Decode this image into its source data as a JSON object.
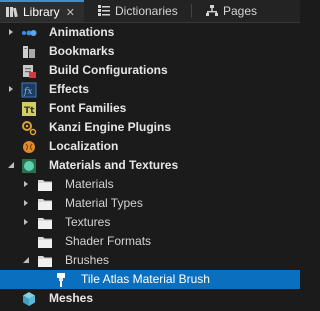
{
  "tabs": [
    {
      "label": "Library",
      "icon": "library-icon",
      "active": true
    },
    {
      "label": "Dictionaries",
      "icon": "dictionaries-icon",
      "active": false
    },
    {
      "label": "Pages",
      "icon": "pages-icon",
      "active": false
    }
  ],
  "tree": [
    {
      "label": "Animations",
      "icon": "animation-icon",
      "arrow": "collapsed"
    },
    {
      "label": "Bookmarks",
      "icon": "bookmark-icon",
      "arrow": "none"
    },
    {
      "label": "Build Configurations",
      "icon": "build-config-icon",
      "arrow": "none"
    },
    {
      "label": "Effects",
      "icon": "effects-icon",
      "arrow": "collapsed"
    },
    {
      "label": "Font Families",
      "icon": "font-icon",
      "arrow": "none"
    },
    {
      "label": "Kanzi Engine Plugins",
      "icon": "plugin-icon",
      "arrow": "none"
    },
    {
      "label": "Localization",
      "icon": "localization-icon",
      "arrow": "none"
    },
    {
      "label": "Materials and Textures",
      "icon": "materials-icon",
      "arrow": "expanded"
    },
    {
      "label": "Materials",
      "icon": "folder-icon",
      "arrow": "collapsed"
    },
    {
      "label": "Material Types",
      "icon": "folder-icon",
      "arrow": "collapsed"
    },
    {
      "label": "Textures",
      "icon": "folder-icon",
      "arrow": "collapsed"
    },
    {
      "label": "Shader Formats",
      "icon": "folder-icon",
      "arrow": "none"
    },
    {
      "label": "Brushes",
      "icon": "folder-icon",
      "arrow": "expanded"
    },
    {
      "label": "Tile Atlas Material Brush",
      "icon": "brush-icon",
      "arrow": "none",
      "selected": true
    },
    {
      "label": "Meshes",
      "icon": "mesh-icon",
      "arrow": "none"
    }
  ],
  "colors": {
    "selection": "#0b6fc0",
    "tab_accent": "#3e8fd0",
    "background": "#1b1b1b"
  }
}
